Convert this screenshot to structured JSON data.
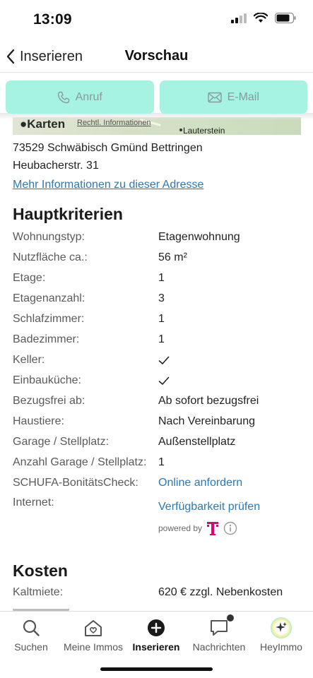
{
  "status_bar": {
    "time": "13:09"
  },
  "nav": {
    "back_label": "Inserieren",
    "title": "Vorschau"
  },
  "contact": {
    "call_label": "Anruf",
    "email_label": "E-Mail",
    "button_color": "#a6f3e2"
  },
  "map": {
    "brand": "Karten",
    "legal": "Rechtl. Informationen",
    "place": "Lauterstein"
  },
  "address": {
    "line1": "73529 Schwäbisch Gmünd Bettringen",
    "line2": "Heubacherstr. 31",
    "more_link": "Mehr Informationen zu dieser Adresse"
  },
  "hauptkriterien": {
    "title": "Hauptkriterien",
    "rows": [
      {
        "label": "Wohnungstyp:",
        "value": "Etagenwohnung"
      },
      {
        "label": "Nutzfläche ca.:",
        "value": "56 m²"
      },
      {
        "label": "Etage:",
        "value": "1"
      },
      {
        "label": "Etagenanzahl:",
        "value": "3"
      },
      {
        "label": "Schlafzimmer:",
        "value": "1"
      },
      {
        "label": "Badezimmer:",
        "value": "1"
      },
      {
        "label": "Keller:",
        "value": ""
      },
      {
        "label": "Einbauküche:",
        "value": ""
      },
      {
        "label": "Bezugsfrei ab:",
        "value": "Ab sofort bezugsfrei"
      },
      {
        "label": "Haustiere:",
        "value": "Nach Vereinbarung"
      },
      {
        "label": "Garage / Stellplatz:",
        "value": "Außenstellplatz"
      },
      {
        "label": "Anzahl Garage / Stellplatz:",
        "value": "1"
      },
      {
        "label": "SCHUFA-BonitätsCheck:",
        "value": "Online anfordern"
      }
    ],
    "internet_label": "Internet:",
    "internet_value": "Verfügbarkeit prüfen",
    "powered_by": "powered by"
  },
  "kosten": {
    "title": "Kosten",
    "kaltmiete_label": "Kaltmiete:",
    "kaltmiete_value": "620 € zzgl. Nebenkosten"
  },
  "tabs": [
    {
      "label": "Suchen",
      "icon": "search-icon"
    },
    {
      "label": "Meine Immos",
      "icon": "house-heart-icon"
    },
    {
      "label": "Inserieren",
      "icon": "plus-circle-icon",
      "active": true
    },
    {
      "label": "Nachrichten",
      "icon": "chat-bubble-icon"
    },
    {
      "label": "HeyImmo",
      "icon": "sparkle-icon"
    }
  ],
  "colors": {
    "link": "#2b79b3",
    "brand_magenta": "#e20074"
  }
}
